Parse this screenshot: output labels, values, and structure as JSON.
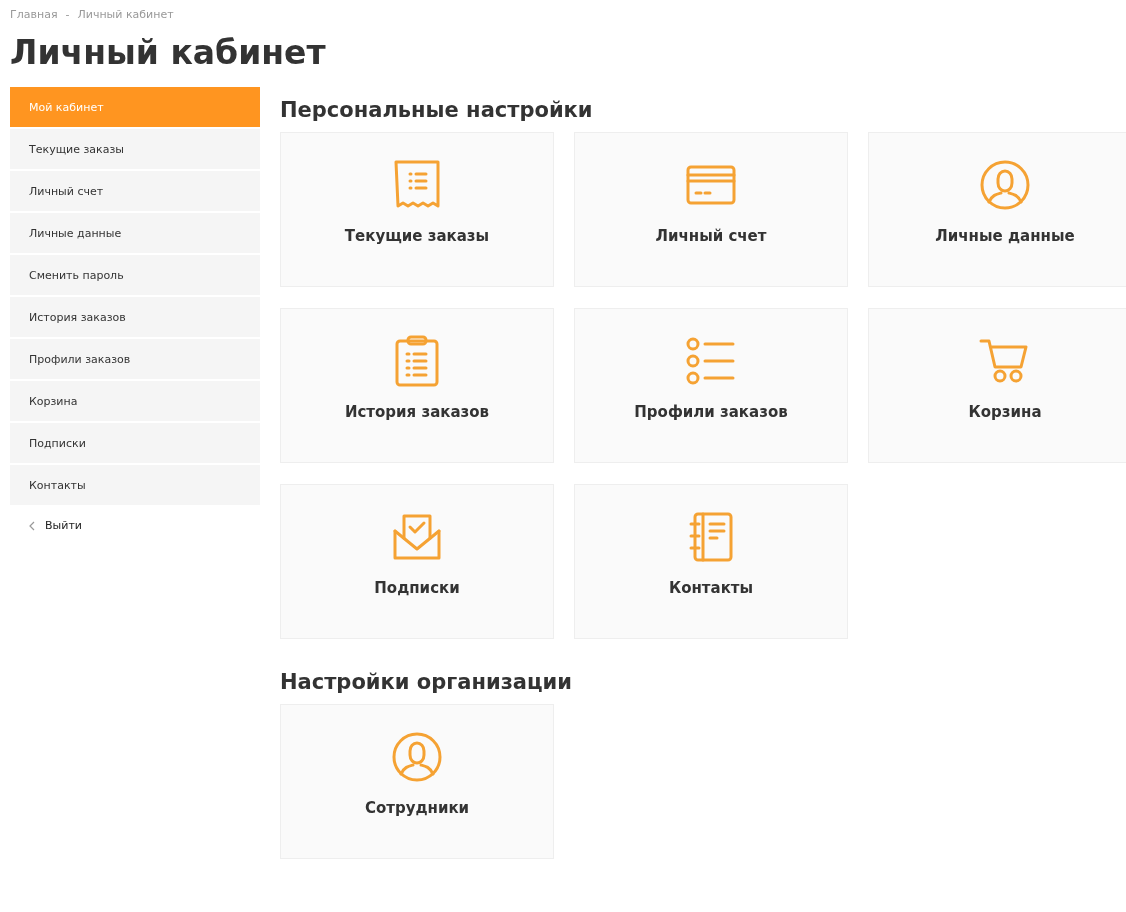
{
  "breadcrumbs": [
    "Главная",
    "-",
    "Личный кабинет"
  ],
  "title": "Личный кабинет",
  "sidebar": {
    "items": [
      {
        "label": "Мой кабинет",
        "selected": true
      },
      {
        "label": "Текущие заказы",
        "selected": false
      },
      {
        "label": "Личный счет",
        "selected": false
      },
      {
        "label": "Личные данные",
        "selected": false
      },
      {
        "label": "Сменить пароль",
        "selected": false
      },
      {
        "label": "История заказов",
        "selected": false
      },
      {
        "label": "Профили заказов",
        "selected": false
      },
      {
        "label": "Корзина",
        "selected": false
      },
      {
        "label": "Подписки",
        "selected": false
      },
      {
        "label": "Контакты",
        "selected": false
      }
    ],
    "logout": "Выйти"
  },
  "sections": [
    {
      "title": "Персональные настройки",
      "cards": [
        {
          "label": "Текущие заказы",
          "kind": "receipt"
        },
        {
          "label": "Личный счет",
          "kind": "card"
        },
        {
          "label": "Личные данные",
          "kind": "user"
        },
        {
          "label": "История заказов",
          "kind": "clipboard"
        },
        {
          "label": "Профили заказов",
          "kind": "list"
        },
        {
          "label": "Корзина",
          "kind": "cart"
        },
        {
          "label": "Подписки",
          "kind": "mail"
        },
        {
          "label": "Контакты",
          "kind": "notebook"
        }
      ]
    },
    {
      "title": "Настройки организации",
      "cards": [
        {
          "label": "Сотрудники",
          "kind": "user"
        }
      ]
    }
  ]
}
